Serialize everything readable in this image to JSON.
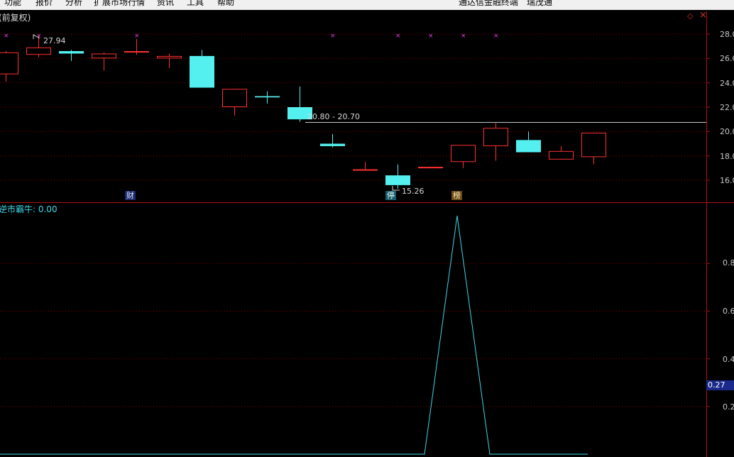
{
  "menu": {
    "items": [
      "功能",
      "报价",
      "分析",
      "扩展市场行情",
      "资讯",
      "工具",
      "帮助"
    ],
    "app_title": "通达信金融终端",
    "app_subtitle": "瑞茂通"
  },
  "price_panel": {
    "title": "(前复权)",
    "high_label": "27.94",
    "low_label": "15.26",
    "range_label": "20.80 - 20.70",
    "badges": {
      "cai": "财",
      "ting": "停",
      "bang": "榜"
    },
    "axis_ticks": [
      "28.0",
      "26.0",
      "24.0",
      "22.0",
      "20.0",
      "18.0",
      "16.0"
    ],
    "colors": {
      "up": "#ff3030",
      "down": "#54f0f0",
      "marker": "#e040e0",
      "grid": "#8b0000"
    }
  },
  "indicator_panel": {
    "title": "逆市霸牛: ",
    "value": "0.00",
    "axis_ticks": [
      "0.8",
      "0.6",
      "0.4",
      "0.2"
    ],
    "current_value": "0.27",
    "color": "#3fd8e8"
  },
  "chart_data": [
    {
      "type": "candlestick",
      "candles": [
        {
          "open": 24.7,
          "close": 26.5,
          "high": 26.6,
          "low": 24.1
        },
        {
          "open": 26.3,
          "close": 26.9,
          "high": 27.9,
          "low": 26.1
        },
        {
          "open": 26.6,
          "close": 26.4,
          "high": 26.7,
          "low": 25.8
        },
        {
          "open": 26.0,
          "close": 26.4,
          "high": 26.5,
          "low": 25.0
        },
        {
          "open": 26.5,
          "close": 26.6,
          "high": 27.6,
          "low": 26.3
        },
        {
          "open": 26.0,
          "close": 26.2,
          "high": 26.4,
          "low": 25.2
        },
        {
          "open": 26.2,
          "close": 23.6,
          "high": 26.7,
          "low": 23.6
        },
        {
          "open": 22.0,
          "close": 23.5,
          "high": 23.5,
          "low": 21.3
        },
        {
          "open": 22.9,
          "close": 22.8,
          "high": 23.3,
          "low": 22.3
        },
        {
          "open": 22.0,
          "close": 21.0,
          "high": 23.7,
          "low": 20.8
        },
        {
          "open": 19.0,
          "close": 18.8,
          "high": 19.8,
          "low": 18.7
        },
        {
          "open": 16.9,
          "close": 16.9,
          "high": 17.5,
          "low": 16.9
        },
        {
          "open": 16.4,
          "close": 15.6,
          "high": 17.3,
          "low": 15.3
        },
        {
          "open": 17.1,
          "close": 17.1,
          "high": 17.1,
          "low": 17.1
        },
        {
          "open": 17.5,
          "close": 18.9,
          "high": 18.9,
          "low": 17.0
        },
        {
          "open": 18.8,
          "close": 20.3,
          "high": 20.7,
          "low": 17.6
        },
        {
          "open": 19.3,
          "close": 18.3,
          "high": 20.0,
          "low": 18.3
        },
        {
          "open": 17.7,
          "close": 18.4,
          "high": 18.8,
          "low": 17.7
        },
        {
          "open": 17.9,
          "close": 19.9,
          "high": 19.9,
          "low": 17.3
        }
      ],
      "markers_at_index": [
        0,
        1,
        4,
        10,
        12,
        13,
        14,
        15
      ],
      "y_range": [
        15.0,
        29.0
      ],
      "reference_line": 20.75
    },
    {
      "type": "line",
      "values": [
        0,
        0,
        0,
        0,
        0,
        0,
        0,
        0,
        0,
        0,
        0,
        0,
        0,
        0,
        1.0,
        0,
        0,
        0,
        0
      ],
      "y_range": [
        0,
        1.0
      ]
    }
  ]
}
